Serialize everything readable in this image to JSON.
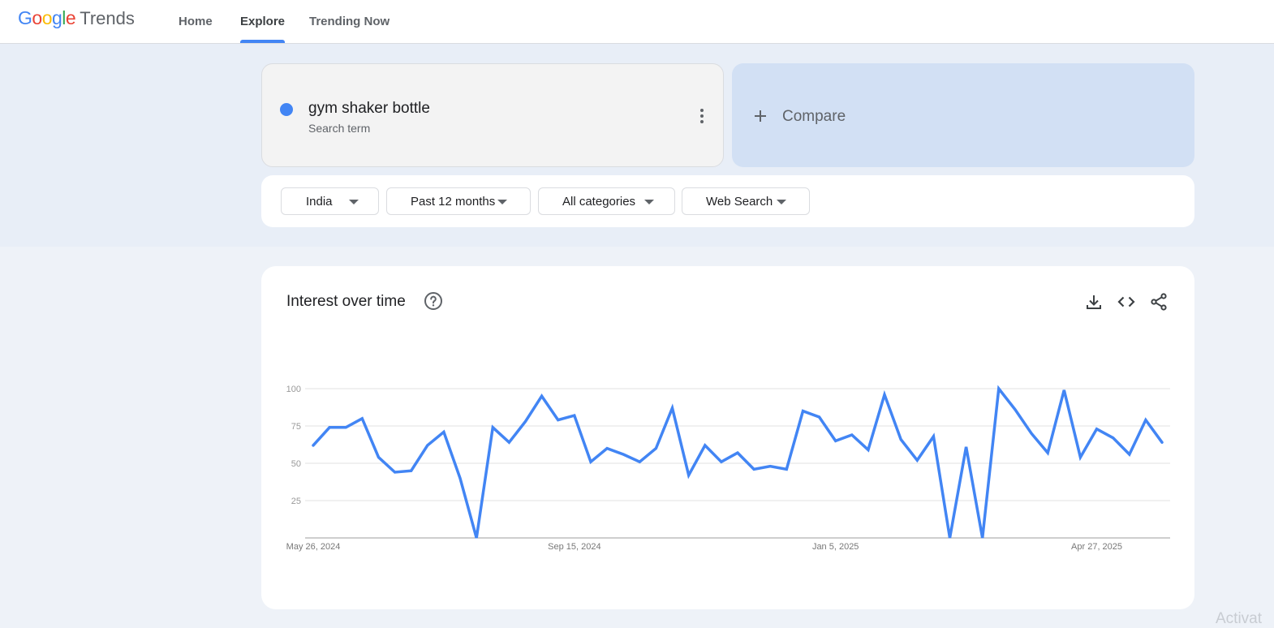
{
  "header": {
    "logo": {
      "letters": [
        {
          "ch": "G",
          "color": "#4285F4"
        },
        {
          "ch": "o",
          "color": "#EA4335"
        },
        {
          "ch": "o",
          "color": "#FBBC05"
        },
        {
          "ch": "g",
          "color": "#4285F4"
        },
        {
          "ch": "l",
          "color": "#34A853"
        },
        {
          "ch": "e",
          "color": "#EA4335"
        }
      ],
      "product": "Trends"
    },
    "nav": [
      {
        "label": "Home",
        "active": false
      },
      {
        "label": "Explore",
        "active": true
      },
      {
        "label": "Trending Now",
        "active": false
      }
    ]
  },
  "search": {
    "term": "gym shaker bottle",
    "term_type": "Search term",
    "term_color": "#4285F4",
    "more_icon": "more-vert-icon",
    "compare_label": "Compare",
    "compare_icon": "plus-icon"
  },
  "filters": [
    {
      "label": "India"
    },
    {
      "label": "Past 12 months"
    },
    {
      "label": "All categories"
    },
    {
      "label": "Web Search"
    }
  ],
  "interest": {
    "title": "Interest over time",
    "help_icon": "help-circle-icon",
    "tools": [
      "download-icon",
      "embed-code-icon",
      "share-icon"
    ]
  },
  "chart_data": {
    "type": "line",
    "title": "Interest over time",
    "xlabel": "",
    "ylabel": "",
    "ylim": [
      0,
      100
    ],
    "yticks": [
      25,
      50,
      75,
      100
    ],
    "grid": true,
    "xtick_labels": [
      {
        "label": "May 26, 2024",
        "index": 0
      },
      {
        "label": "Sep 15, 2024",
        "index": 16
      },
      {
        "label": "Jan 5, 2025",
        "index": 32
      },
      {
        "label": "Apr 27, 2025",
        "index": 48
      }
    ],
    "series": [
      {
        "color": "#4285F4",
        "values": [
          62,
          74,
          74,
          80,
          54,
          44,
          45,
          62,
          71,
          40,
          0,
          74,
          64,
          78,
          95,
          79,
          82,
          51,
          60,
          56,
          51,
          60,
          87,
          42,
          62,
          51,
          57,
          46,
          48,
          46,
          85,
          81,
          65,
          69,
          59,
          96,
          66,
          52,
          68,
          0,
          61,
          0,
          100,
          86,
          70,
          57,
          99,
          54,
          73,
          67,
          56,
          79,
          64
        ]
      }
    ]
  },
  "watermark": "Activat"
}
